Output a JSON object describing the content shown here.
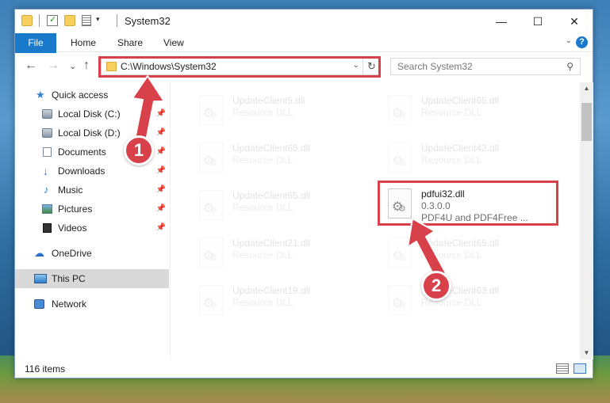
{
  "window": {
    "title": "System32",
    "minimize_glyph": "—",
    "maximize_glyph": "☐",
    "close_glyph": "✕"
  },
  "ribbon": {
    "tabs": [
      "File",
      "Home",
      "Share",
      "View"
    ]
  },
  "nav": {
    "back_glyph": "←",
    "forward_glyph": "→",
    "recent_glyph": "⌄",
    "up_glyph": "↑",
    "address": "C:\\Windows\\System32",
    "refresh_glyph": "↻",
    "search_placeholder": "Search System32",
    "search_glyph": "⚲"
  },
  "sidebar": {
    "items": [
      {
        "label": "Quick access",
        "icon": "star-icon",
        "pinned": false
      },
      {
        "label": "Local Disk (C:)",
        "icon": "disk-icon",
        "pinned": true
      },
      {
        "label": "Local Disk (D:)",
        "icon": "disk-icon",
        "pinned": true
      },
      {
        "label": "Documents",
        "icon": "documents-icon",
        "pinned": true
      },
      {
        "label": "Downloads",
        "icon": "download-icon",
        "pinned": true
      },
      {
        "label": "Music",
        "icon": "music-icon",
        "pinned": true
      },
      {
        "label": "Pictures",
        "icon": "pictures-icon",
        "pinned": true
      },
      {
        "label": "Videos",
        "icon": "videos-icon",
        "pinned": true
      },
      {
        "label": "OneDrive",
        "icon": "cloud-icon",
        "pinned": false
      },
      {
        "label": "This PC",
        "icon": "pc-icon",
        "pinned": false,
        "selected": true
      },
      {
        "label": "Network",
        "icon": "network-icon",
        "pinned": false
      }
    ],
    "pin_glyph": "📌"
  },
  "files": {
    "left": [
      {
        "name": "UpdateClient5.dll",
        "desc": "Resource DLL"
      },
      {
        "name": "UpdateClient65.dll",
        "desc": "Resource DLL"
      },
      {
        "name": "UpdateClient65.dll",
        "desc": "Resource DLL"
      },
      {
        "name": "UpdateClient21.dll",
        "desc": "Resource DLL"
      },
      {
        "name": "UpdateClient19.dll",
        "desc": "Resource DLL"
      }
    ],
    "right": [
      {
        "name": "UpdateClient65.dll",
        "desc": "Resource DLL"
      },
      {
        "name": "UpdateClient42.dll",
        "desc": "Resource DLL"
      },
      {
        "name": "pdfui32.dll",
        "desc": "0.3.0.0",
        "extra": "PDF4U and PDF4Free ...",
        "highlight": true
      },
      {
        "name": "UpdateClient65.dll",
        "desc": "Resource DLL"
      },
      {
        "name": "UpdateClient63.dll",
        "desc": "Resource DLL"
      }
    ]
  },
  "status": {
    "item_count": "116 items"
  },
  "annotations": {
    "step1": "1",
    "step2": "2",
    "color": "#d9414a"
  }
}
